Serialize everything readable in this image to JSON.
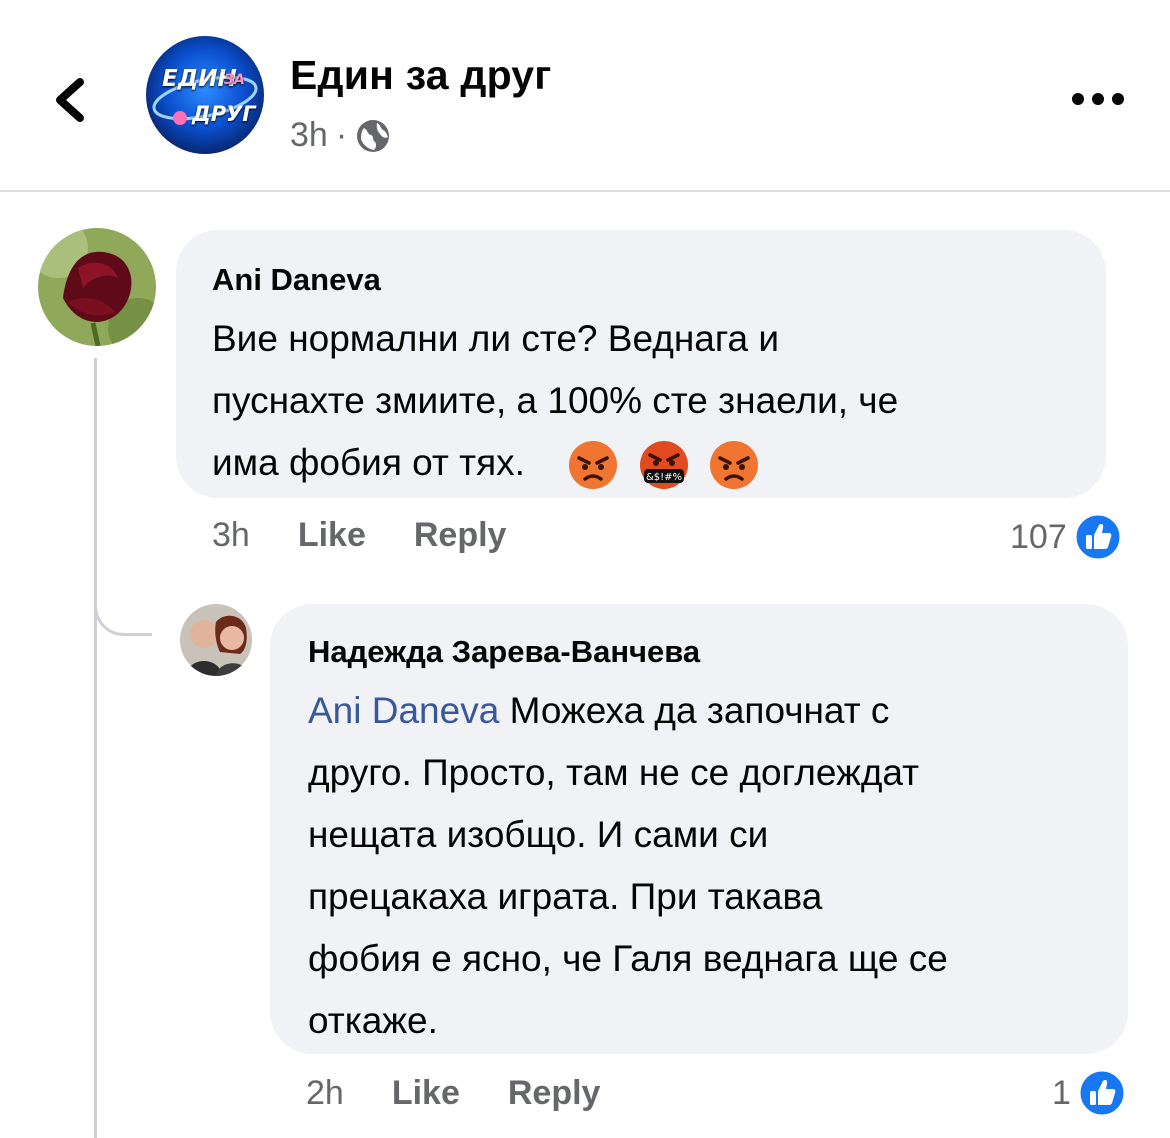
{
  "header": {
    "page_name": "Един за друг",
    "time": "3h",
    "separator": "·",
    "logo_line1": "ЕДИН",
    "logo_line1b": "ЗА",
    "logo_line2": "ДРУГ",
    "icons": {
      "back": "chevron-left-icon",
      "privacy": "globe-icon",
      "more": "more-dots-icon"
    }
  },
  "comments": [
    {
      "author": "Ani Daneva",
      "text_lines": [
        "Вие нормални ли сте? Веднага и",
        "пуснахте змиите, а 100% сте знаели, че",
        "има фобия от тях."
      ],
      "emojis": [
        "angry-face",
        "face-with-symbols-on-mouth",
        "angry-face"
      ],
      "emoji_symbols_text": "&$!#%",
      "time": "3h",
      "like_label": "Like",
      "reply_label": "Reply",
      "like_count": "107"
    },
    {
      "author": "Надежда Зарева-Ванчева",
      "mention": "Ani Daneva",
      "first_line_rest": " Можеха да започнат с",
      "text_lines": [
        "друго. Просто, там не се доглеждат",
        "нещата изобщо. И сами си",
        "прецакаха играта. При такава",
        "фобия е ясно, че Галя веднага ще се",
        "откаже."
      ],
      "time": "2h",
      "like_label": "Like",
      "reply_label": "Reply",
      "like_count": "1"
    }
  ],
  "colors": {
    "bubble": "#f0f2f5",
    "secondary_text": "#65676b",
    "mention": "#385898",
    "like_blue": "#1877f2"
  }
}
